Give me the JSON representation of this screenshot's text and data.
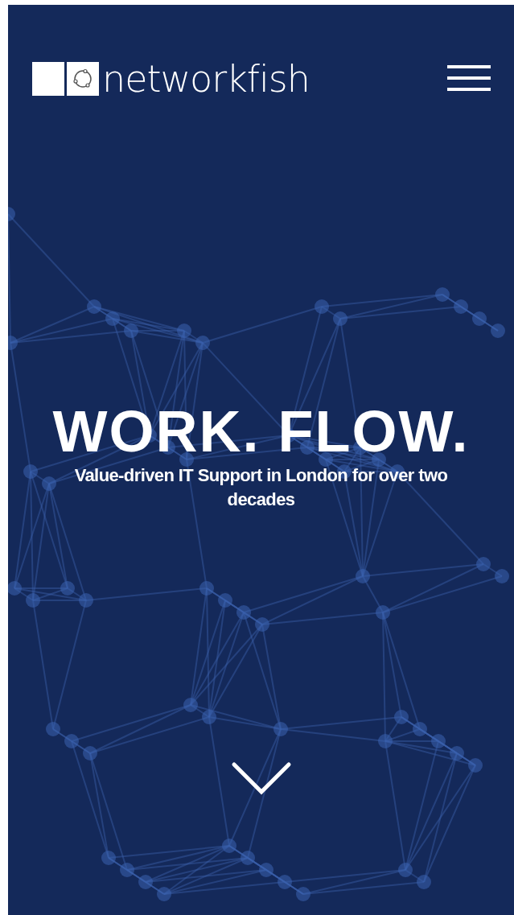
{
  "header": {
    "brand": "networkfish"
  },
  "hero": {
    "headline": "WORK. FLOW.",
    "subtitle": "Value-driven IT Support in London for over two decades"
  }
}
